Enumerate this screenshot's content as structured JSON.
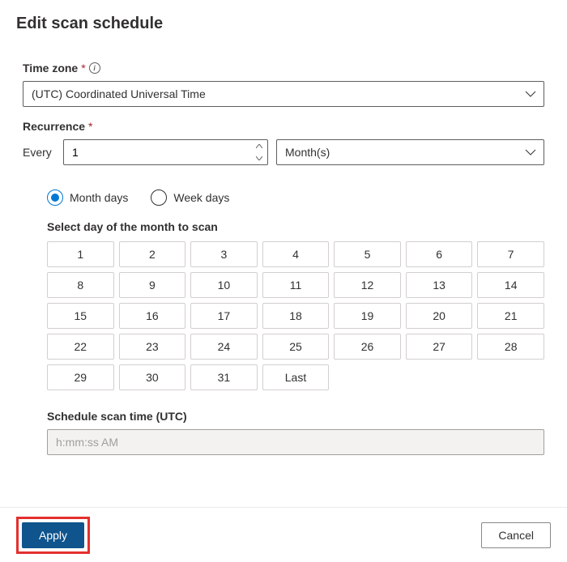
{
  "title": "Edit scan schedule",
  "timezone": {
    "label": "Time zone",
    "value": "(UTC) Coordinated Universal Time"
  },
  "recurrence": {
    "label": "Recurrence",
    "every_label": "Every",
    "every_value": "1",
    "unit_value": "Month(s)"
  },
  "dayType": {
    "month_days": "Month days",
    "week_days": "Week days"
  },
  "selectDay": {
    "heading": "Select day of the month to scan",
    "days": [
      "1",
      "2",
      "3",
      "4",
      "5",
      "6",
      "7",
      "8",
      "9",
      "10",
      "11",
      "12",
      "13",
      "14",
      "15",
      "16",
      "17",
      "18",
      "19",
      "20",
      "21",
      "22",
      "23",
      "24",
      "25",
      "26",
      "27",
      "28",
      "29",
      "30",
      "31",
      "Last"
    ]
  },
  "scanTime": {
    "label": "Schedule scan time (UTC)",
    "placeholder": "h:mm:ss AM"
  },
  "buttons": {
    "apply": "Apply",
    "cancel": "Cancel"
  }
}
